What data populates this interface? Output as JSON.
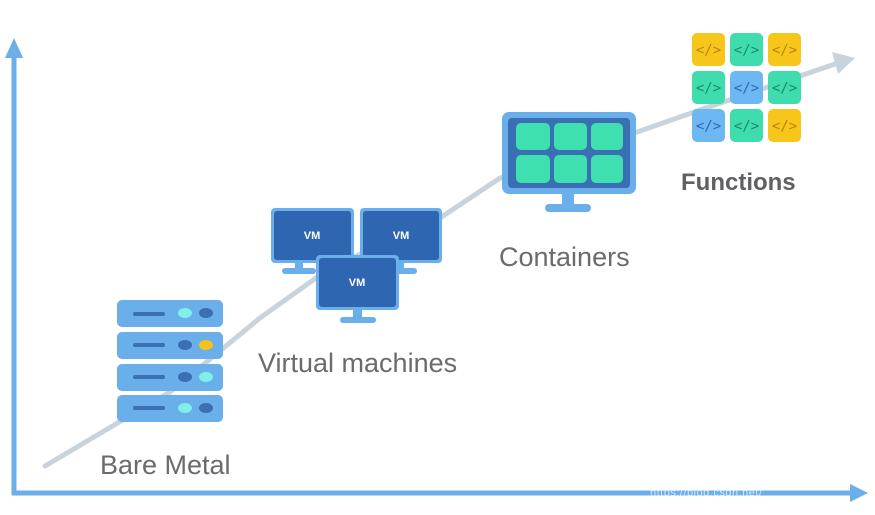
{
  "diagram": {
    "stages": [
      {
        "name": "Bare Metal",
        "icon": "server-rack-icon"
      },
      {
        "name": "Virtual machines",
        "icon": "vm-monitors-icon",
        "monitor_label": "VM"
      },
      {
        "name": "Containers",
        "icon": "container-monitor-icon"
      },
      {
        "name": "Functions",
        "icon": "function-grid-icon",
        "tile_label": "</>"
      }
    ],
    "function_tiles": [
      [
        "yellow",
        "green",
        "yellow"
      ],
      [
        "green",
        "blue",
        "green"
      ],
      [
        "blue",
        "green",
        "yellow"
      ]
    ],
    "colors": {
      "axis": "#6aaeea",
      "trend": "#c9d3db",
      "server_body": "#6aaeea",
      "server_dark": "#3a6fb3",
      "server_light": "#7ef0e6",
      "server_yellow": "#f2c41b",
      "vm_dark": "#2f66b1",
      "monitor_frame": "#6aaeea",
      "container_tile": "#3fe0b0",
      "tile_yellow": "#f7c61b",
      "tile_green": "#3fdcae",
      "tile_blue": "#6db8f3"
    },
    "watermark": "https://blog.csdn.net/"
  }
}
